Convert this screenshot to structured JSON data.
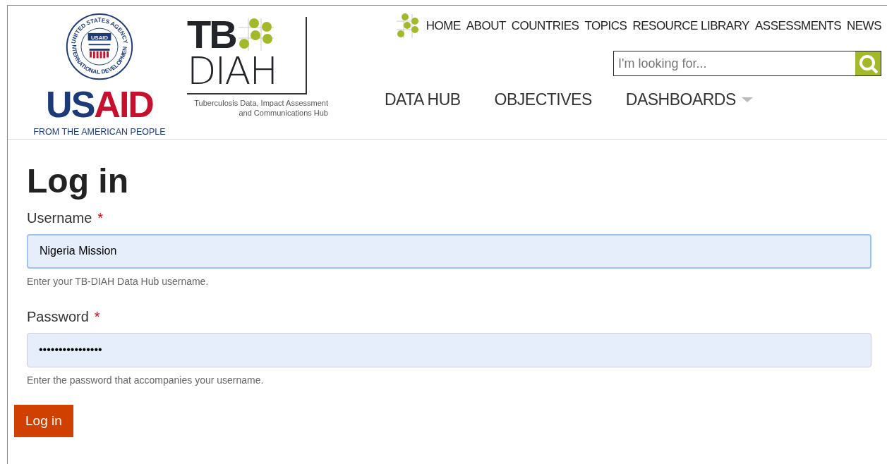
{
  "header": {
    "usaid_logo": {
      "seal_top": "UNITED STATES AGENCY",
      "seal_bottom": "INTERNATIONAL DEVELOPMENT",
      "seal_center": "USAID",
      "wordmark_a": "US",
      "wordmark_b": "AID",
      "tagline": "FROM THE AMERICAN PEOPLE"
    },
    "tbdiah_logo": {
      "line_1": "TB",
      "line_2": "DIAH",
      "tagline": "Tuberculosis Data, Impact Assessment and Communications Hub"
    },
    "top_nav": [
      {
        "label": "HOME"
      },
      {
        "label": "ABOUT"
      },
      {
        "label": "COUNTRIES"
      },
      {
        "label": "TOPICS"
      },
      {
        "label": "RESOURCE LIBRARY"
      },
      {
        "label": "ASSESSMENTS"
      },
      {
        "label": "NEWS"
      }
    ],
    "search": {
      "placeholder": "I'm looking for..."
    },
    "main_nav": [
      {
        "label": "DATA HUB",
        "dropdown": false
      },
      {
        "label": "OBJECTIVES",
        "dropdown": false
      },
      {
        "label": "DASHBOARDS",
        "dropdown": true
      }
    ]
  },
  "form": {
    "title": "Log in",
    "fields": [
      {
        "label": "Username",
        "required_mark": "*",
        "value": "Nigeria Mission",
        "focused": true,
        "help": "Enter your TB-DIAH Data Hub username."
      },
      {
        "label": "Password",
        "required_mark": "*",
        "value": "••••••••••••••••",
        "focused": false,
        "help": "Enter the password that accompanies your username."
      }
    ],
    "submit": "Log in"
  }
}
